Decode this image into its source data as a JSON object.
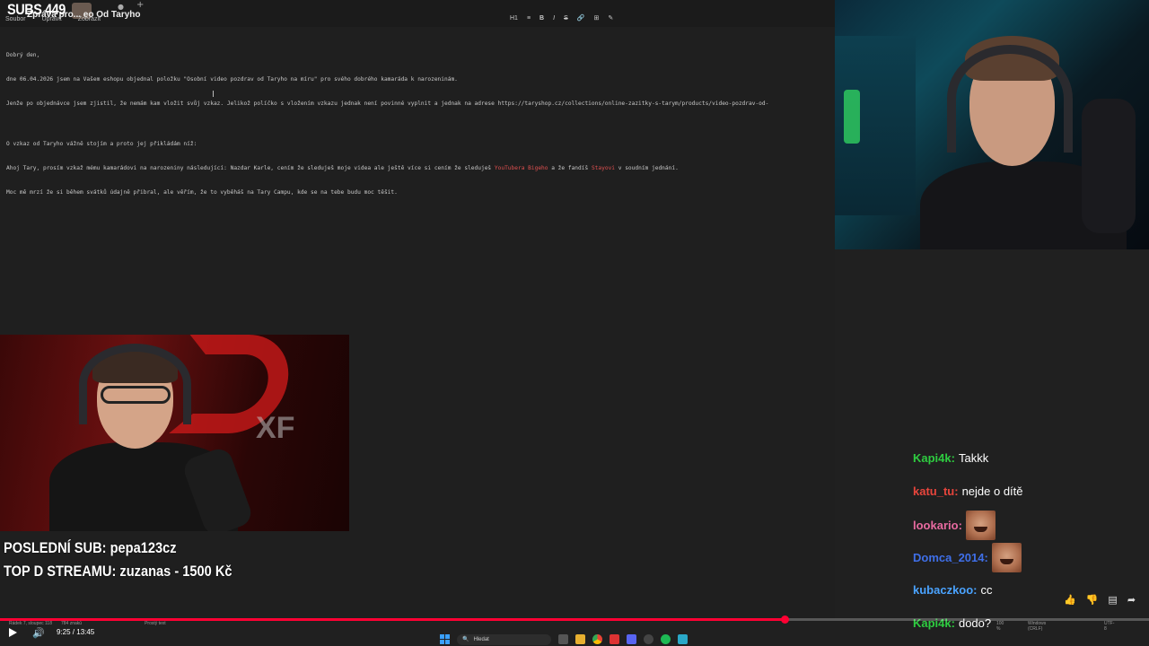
{
  "stream": {
    "subs_counter": "SUBS 449",
    "last_sub": "POSLEDNÍ SUB: pepa123cz",
    "top_donation": "TOP D STREAMU: zuzanas - 1500 Kč"
  },
  "editor": {
    "tab_title": "Zpráva pro... eo Od Taryho",
    "menu": [
      "Soubor",
      "Upravit",
      "Zobrazit"
    ],
    "toolbar": [
      "H1",
      "≡",
      "B",
      "I",
      "S",
      "🔗",
      "⊞",
      "✎"
    ],
    "lines": [
      "Dobrý den,",
      "dne 06.04.2026 jsem na Vašem eshopu objednal položku \"Osobní video pozdrav od Taryho na míru\" pro svého dobrého kamaráda k narozeninám.",
      "Jenže po objednávce jsem zjistil, že nemám kam vložit svůj vzkaz. Jelikož políčko s vložením vzkazu jednak není povinné vyplnit a jednak na adrese https://taryshop.cz/collections/online-zazitky-s-tarym/products/video-pozdrav-od-",
      "",
      "O vzkaz od Taryho vážně stojím a proto jej přikládám níž:"
    ],
    "line_red_1_pre": "Ahoj Tary, prosím vzkaž mému kamarádovi na narozeniny následující: Nazdar Karle, cením že sleduješ moje videa ale ještě více si cením že sleduješ ",
    "line_red_1_red1": "YouTubera Bigeho",
    "line_red_1_mid": " a že fandíš ",
    "line_red_1_red2": "Stayovi",
    "line_red_1_post": " v soudním jednání.",
    "line_last": "Moc mě mrzí že si během svátků údajně přibral, ale věřím, že to vyběháš na Tary Campu, kde se na tebe budu moc těšit."
  },
  "chat": {
    "messages": [
      {
        "user": "Kapi4k:",
        "color": "#2ecc40",
        "text": "Takkk",
        "emote": false
      },
      {
        "user": "katu_tu:",
        "color": "#e8453c",
        "text": "nejde o dítě",
        "emote": false
      },
      {
        "user": "lookario:",
        "color": "#e86aa0",
        "text": "",
        "emote": true
      },
      {
        "user": "Domca_2014:",
        "color": "#3f6fe8",
        "text": "",
        "emote": true
      },
      {
        "user": "kubaczkoo:",
        "color": "#4aa3ff",
        "text": "cc",
        "emote": false
      },
      {
        "user": "Kapi4k:",
        "color": "#2ecc40",
        "text": "dodo?",
        "emote": false
      }
    ]
  },
  "player": {
    "time": "9:25 / 13:45",
    "progress": 0.683
  },
  "statusbar": {
    "position": "Řádek 7, sloupec 118",
    "chars": "784 znaků",
    "format": "Prostý text",
    "zoom": "100 %",
    "eol": "Windows (CRLF)",
    "encoding": "UTF-8"
  },
  "taskbar": {
    "search_label": "Hledat"
  },
  "colors": {
    "accent_red": "#ff0033",
    "editor_bg": "#1f1f1f"
  }
}
